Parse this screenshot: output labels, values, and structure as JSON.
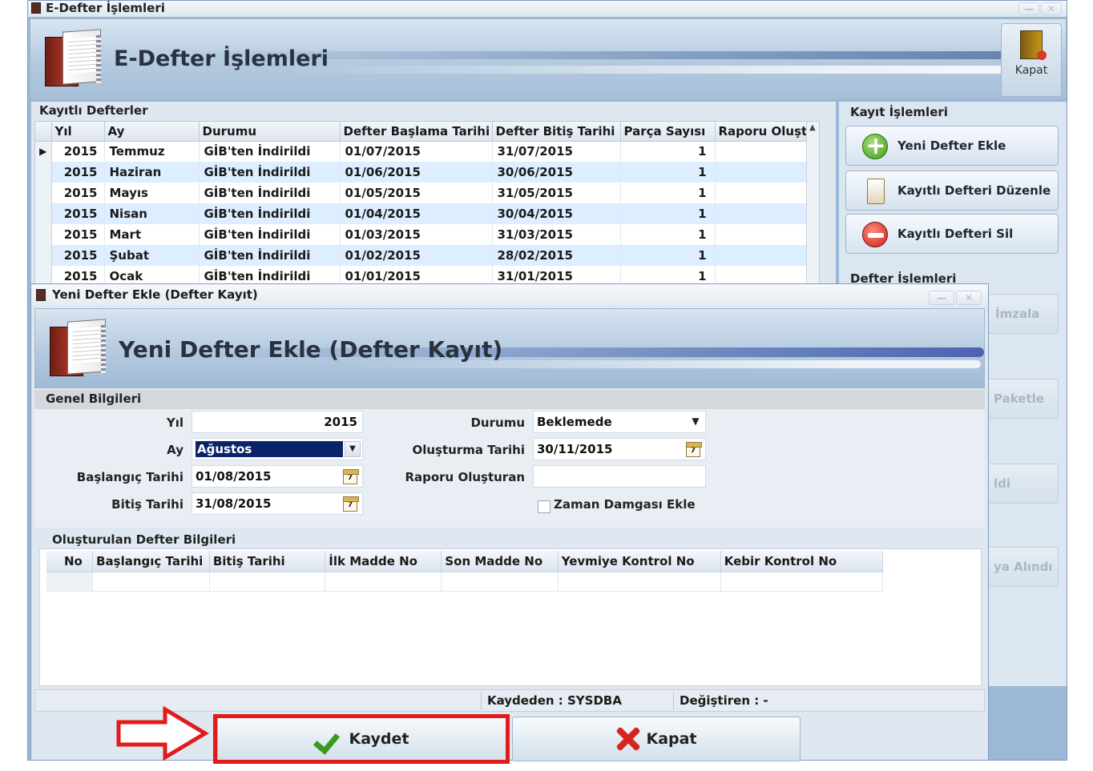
{
  "main": {
    "title": "E-Defter İşlemleri",
    "banner_title": "E-Defter İşlemleri",
    "close_label": "Kapat",
    "grid_group": "Kayıtlı Defterler",
    "columns": [
      "Yıl",
      "Ay",
      "Durumu",
      "Defter Başlama Tarihi",
      "Defter Bitiş Tarihi",
      "Parça Sayısı",
      "Raporu Oluştu"
    ],
    "rows": [
      {
        "yil": "2015",
        "ay": "Temmuz",
        "durum": "GİB'ten İndirildi",
        "bas": "01/07/2015",
        "bit": "31/07/2015",
        "parca": "1"
      },
      {
        "yil": "2015",
        "ay": "Haziran",
        "durum": "GİB'ten İndirildi",
        "bas": "01/06/2015",
        "bit": "30/06/2015",
        "parca": "1"
      },
      {
        "yil": "2015",
        "ay": "Mayıs",
        "durum": "GİB'ten İndirildi",
        "bas": "01/05/2015",
        "bit": "31/05/2015",
        "parca": "1"
      },
      {
        "yil": "2015",
        "ay": "Nisan",
        "durum": "GİB'ten İndirildi",
        "bas": "01/04/2015",
        "bit": "30/04/2015",
        "parca": "1"
      },
      {
        "yil": "2015",
        "ay": "Mart",
        "durum": "GİB'ten İndirildi",
        "bas": "01/03/2015",
        "bit": "31/03/2015",
        "parca": "1"
      },
      {
        "yil": "2015",
        "ay": "Şubat",
        "durum": "GİB'ten İndirildi",
        "bas": "01/02/2015",
        "bit": "28/02/2015",
        "parca": "1"
      },
      {
        "yil": "2015",
        "ay": "Ocak",
        "durum": "GİB'ten İndirildi",
        "bas": "01/01/2015",
        "bit": "31/01/2015",
        "parca": "1"
      }
    ],
    "side": {
      "kayit_group": "Kayıt İşlemleri",
      "new_label": "Yeni Defter Ekle",
      "edit_label": "Kayıtlı Defteri Düzenle",
      "delete_label": "Kayıtlı Defteri Sil",
      "defter_group": "Defter İşlemleri",
      "imzala": "İmzala",
      "paketle": "Paketle",
      "ldi": "ldi",
      "alindi": "ya Alındı"
    }
  },
  "dialog": {
    "title": "Yeni Defter Ekle (Defter Kayıt)",
    "banner_title": "Yeni Defter Ekle (Defter Kayıt)",
    "genel_group": "Genel Bilgileri",
    "yil_label": "Yıl",
    "yil_value": "2015",
    "ay_label": "Ay",
    "ay_value": "Ağustos",
    "bas_label": "Başlangıç Tarihi",
    "bas_value": "01/08/2015",
    "bit_label": "Bitiş Tarihi",
    "bit_value": "31/08/2015",
    "durum_label": "Durumu",
    "durum_value": "Beklemede",
    "olus_label": "Oluşturma Tarihi",
    "olus_value": "30/11/2015",
    "rapor_label": "Raporu Oluşturan",
    "rapor_value": "",
    "zaman_label": "Zaman Damgası Ekle",
    "cal_glyph": "7",
    "olus_group": "Oluşturulan Defter Bilgileri",
    "olus_columns": [
      "No",
      "Başlangıç Tarihi",
      "Bitiş Tarihi",
      "İlk Madde No",
      "Son Madde No",
      "Yevmiye Kontrol No",
      "Kebir Kontrol No"
    ],
    "kaydeden": "Kaydeden : SYSDBA",
    "degistiren": "Değiştiren :  -",
    "save_label": "Kaydet",
    "close_label": "Kapat"
  },
  "colors": {
    "highlight": "#e21a1a",
    "selection": "#0a246a",
    "window_bg": "#9bb8d6"
  }
}
